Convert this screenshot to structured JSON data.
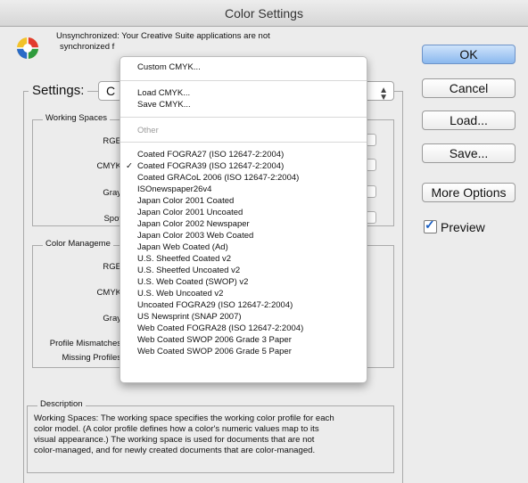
{
  "window": {
    "title": "Color Settings"
  },
  "sync": {
    "icon": "color-wheel-icon",
    "line1": "Unsynchronized: Your Creative Suite applications are not",
    "line2_prefix": "synchronized f"
  },
  "settings": {
    "label": "Settings:",
    "value": "C"
  },
  "working_spaces": {
    "title": "Working Spaces",
    "rgb": "RGE",
    "cmyk": "CMYK",
    "gray": "Gray",
    "spot": "Spot"
  },
  "color_management": {
    "title": "Color Manageme",
    "rgb": "RGE",
    "cmyk": "CMYK",
    "gray": "Gray",
    "profile_mismatches": "Profile Mismatches",
    "missing_profiles": "Missing Profiles"
  },
  "description": {
    "title": "Description",
    "lines": [
      "Working Spaces:  The working space specifies the working color profile for each",
      "color model.  (A color profile defines how a color's numeric values map to its",
      "visual appearance.)  The working space is used for documents that are not",
      "color-managed, and for newly created documents that are color-managed."
    ]
  },
  "buttons": {
    "ok": "OK",
    "cancel": "Cancel",
    "load": "Load...",
    "save": "Save...",
    "more_options": "More Options"
  },
  "preview": {
    "label": "Preview",
    "checked": true
  },
  "menu": {
    "custom": "Custom CMYK...",
    "load": "Load CMYK...",
    "save": "Save CMYK...",
    "other": "Other",
    "selected_index": 1,
    "profiles": [
      "Coated FOGRA27 (ISO 12647-2:2004)",
      "Coated FOGRA39 (ISO 12647-2:2004)",
      "Coated GRACoL 2006 (ISO 12647-2:2004)",
      "ISOnewspaper26v4",
      "Japan Color 2001 Coated",
      "Japan Color 2001 Uncoated",
      "Japan Color 2002 Newspaper",
      "Japan Color 2003 Web Coated",
      "Japan Web Coated (Ad)",
      "U.S. Sheetfed Coated v2",
      "U.S. Sheetfed Uncoated v2",
      "U.S. Web Coated (SWOP) v2",
      "U.S. Web Uncoated v2",
      "Uncoated FOGRA29 (ISO 12647-2:2004)",
      "US Newsprint (SNAP 2007)",
      "Web Coated FOGRA28 (ISO 12647-2:2004)",
      "Web Coated SWOP 2006 Grade 3 Paper",
      "Web Coated SWOP 2006 Grade 5 Paper"
    ]
  }
}
